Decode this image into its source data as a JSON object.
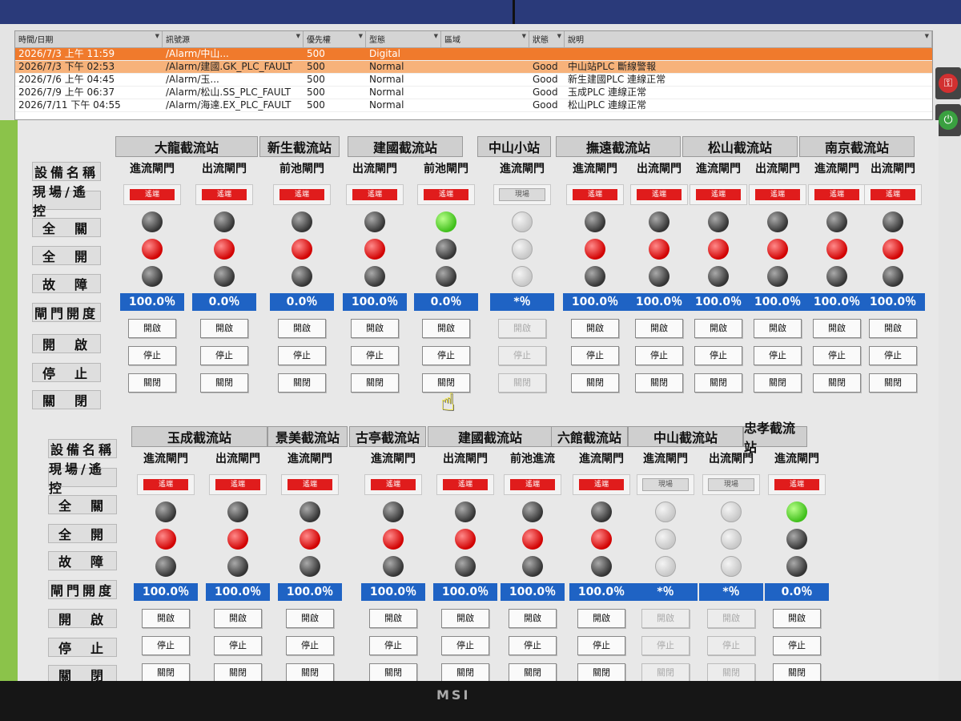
{
  "alarm": {
    "headers": [
      "時間/日期",
      "訊號源",
      "優先權",
      "型態",
      "區域",
      "狀態",
      "說明"
    ],
    "rows": [
      {
        "time": "2026/7/3 上午 11:59",
        "source": "/Alarm/中山...",
        "priority": "500",
        "type": "Digital",
        "area": "",
        "state": "",
        "desc": ""
      },
      {
        "time": "2026/7/3 下午 02:53",
        "source": "/Alarm/建國.GK_PLC_FAULT",
        "priority": "500",
        "type": "Normal",
        "area": "",
        "state": "Good",
        "desc": "中山站PLC 斷線警報"
      },
      {
        "time": "2026/7/6 上午 04:45",
        "source": "/Alarm/玉...",
        "priority": "500",
        "type": "Normal",
        "area": "",
        "state": "Good",
        "desc": "新生建國PLC 連線正常"
      },
      {
        "time": "2026/7/9 上午 06:37",
        "source": "/Alarm/松山.SS_PLC_FAULT",
        "priority": "500",
        "type": "Normal",
        "area": "",
        "state": "Good",
        "desc": "玉成PLC 連線正常"
      },
      {
        "time": "2026/7/11 下午 04:55",
        "source": "/Alarm/海達.EX_PLC_FAULT",
        "priority": "500",
        "type": "Normal",
        "area": "",
        "state": "Good",
        "desc": "松山PLC 連線正常"
      }
    ]
  },
  "row_labels": {
    "name": "設備名稱",
    "mode": "現場/遙控",
    "full_close": "全　關",
    "full_open": "全　開",
    "fault": "故　障",
    "opening": "閘門開度",
    "open": "開　啟",
    "stop": "停　止",
    "close": "關　閉"
  },
  "buttons": {
    "open": "開啟",
    "stop": "停止",
    "close": "關閉"
  },
  "modes": {
    "remote": "遙端",
    "local": "現場"
  },
  "top": {
    "stations": [
      "大龍截流站",
      "新生截流站",
      "建國截流站",
      "中山小站",
      "撫遠截流站",
      "松山截流站",
      "南京截流站"
    ],
    "gates": [
      {
        "name": "進流閘門",
        "mode": "遙端",
        "close": "grey",
        "open": "red",
        "fault": "grey",
        "pct": "100.0％",
        "enabled": true
      },
      {
        "name": "出流閘門",
        "mode": "遙端",
        "close": "grey",
        "open": "red",
        "fault": "grey",
        "pct": "0.0％",
        "enabled": true
      },
      {
        "name": "前池閘門",
        "mode": "遙端",
        "close": "grey",
        "open": "red",
        "fault": "grey",
        "pct": "0.0％",
        "enabled": true
      },
      {
        "name": "出流閘門",
        "mode": "遙端",
        "close": "grey",
        "open": "red",
        "fault": "grey",
        "pct": "100.0％",
        "enabled": true
      },
      {
        "name": "前池閘門",
        "mode": "遙端",
        "close": "green",
        "open": "grey",
        "fault": "grey",
        "pct": "0.0％",
        "enabled": true
      },
      {
        "name": "進流閘門",
        "mode": "現場",
        "close": "off",
        "open": "off",
        "fault": "off",
        "pct": "*％",
        "enabled": false
      },
      {
        "name": "進流閘門",
        "mode": "遙端",
        "close": "grey",
        "open": "red",
        "fault": "grey",
        "pct": "100.0％",
        "enabled": true
      },
      {
        "name": "出流閘門",
        "mode": "遙端",
        "close": "grey",
        "open": "red",
        "fault": "grey",
        "pct": "100.0％",
        "enabled": true
      },
      {
        "name": "進流閘門",
        "mode": "遙端",
        "close": "grey",
        "open": "red",
        "fault": "grey",
        "pct": "100.0％",
        "enabled": true
      },
      {
        "name": "出流閘門",
        "mode": "遙端",
        "close": "grey",
        "open": "red",
        "fault": "grey",
        "pct": "100.0％",
        "enabled": true
      },
      {
        "name": "進流閘門",
        "mode": "遙端",
        "close": "grey",
        "open": "red",
        "fault": "grey",
        "pct": "100.0％",
        "enabled": true
      },
      {
        "name": "出流閘門",
        "mode": "遙端",
        "close": "grey",
        "open": "red",
        "fault": "grey",
        "pct": "100.0％",
        "enabled": true
      }
    ]
  },
  "bottom": {
    "stations": [
      "玉成截流站",
      "景美截流站",
      "古亭截流站",
      "建國截流站",
      "六館截流站",
      "中山截流站",
      "忠孝截流站"
    ],
    "gates": [
      {
        "name": "進流閘門",
        "mode": "遙端",
        "close": "grey",
        "open": "red",
        "fault": "grey",
        "pct": "100.0％",
        "enabled": true
      },
      {
        "name": "出流閘門",
        "mode": "遙端",
        "close": "grey",
        "open": "red",
        "fault": "grey",
        "pct": "100.0％",
        "enabled": true
      },
      {
        "name": "進流閘門",
        "mode": "遙端",
        "close": "grey",
        "open": "red",
        "fault": "grey",
        "pct": "100.0％",
        "enabled": true
      },
      {
        "name": "進流閘門",
        "mode": "遙端",
        "close": "grey",
        "open": "red",
        "fault": "grey",
        "pct": "100.0％",
        "enabled": true
      },
      {
        "name": "出流閘門",
        "mode": "遙端",
        "close": "grey",
        "open": "red",
        "fault": "grey",
        "pct": "100.0％",
        "enabled": true
      },
      {
        "name": "前池進流",
        "mode": "遙端",
        "close": "grey",
        "open": "red",
        "fault": "grey",
        "pct": "100.0％",
        "enabled": true
      },
      {
        "name": "進流閘門",
        "mode": "遙端",
        "close": "grey",
        "open": "red",
        "fault": "grey",
        "pct": "100.0％",
        "enabled": true
      },
      {
        "name": "進流閘門",
        "mode": "現場",
        "close": "off",
        "open": "off",
        "fault": "off",
        "pct": "*％",
        "enabled": false
      },
      {
        "name": "出流閘門",
        "mode": "現場",
        "close": "off",
        "open": "off",
        "fault": "off",
        "pct": "*％",
        "enabled": false
      },
      {
        "name": "進流閘門",
        "mode": "遙端",
        "close": "green",
        "open": "grey",
        "fault": "grey",
        "pct": "0.0％",
        "enabled": true
      }
    ]
  },
  "monitor_brand": "MSI"
}
